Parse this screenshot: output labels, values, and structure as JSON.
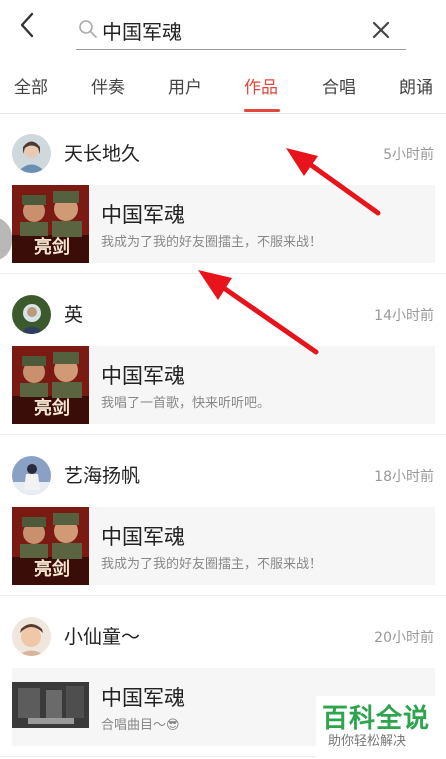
{
  "search": {
    "value": "中国军魂"
  },
  "icons": {
    "back": "chevron-left-icon",
    "search": "magnifier-icon",
    "clear": "close-icon"
  },
  "tabs": [
    {
      "label": "全部",
      "active": false
    },
    {
      "label": "伴奏",
      "active": false
    },
    {
      "label": "用户",
      "active": false
    },
    {
      "label": "作品",
      "active": true
    },
    {
      "label": "合唱",
      "active": false
    },
    {
      "label": "朗诵",
      "active": false
    }
  ],
  "colors": {
    "accent": "#e5463b",
    "annotation_arrow": "#e8141b",
    "watermark": "#2ea44f"
  },
  "feed": [
    {
      "user": "天长地久",
      "time": "5小时前",
      "title": "中国军魂",
      "desc": "我成为了我的好友圈擂主，不服来战！"
    },
    {
      "user": "英",
      "time": "14小时前",
      "title": "中国军魂",
      "desc": "我唱了一首歌，快来听听吧。"
    },
    {
      "user": "艺海扬帆",
      "time": "18小时前",
      "title": "中国军魂",
      "desc": "我成为了我的好友圈擂主，不服来战！"
    },
    {
      "user": "小仙童～",
      "time": "20小时前",
      "title": "中国军魂",
      "desc": "合唱曲目～😎"
    }
  ],
  "watermark": {
    "logo": "百科全说",
    "sub": "助你轻松解决"
  }
}
